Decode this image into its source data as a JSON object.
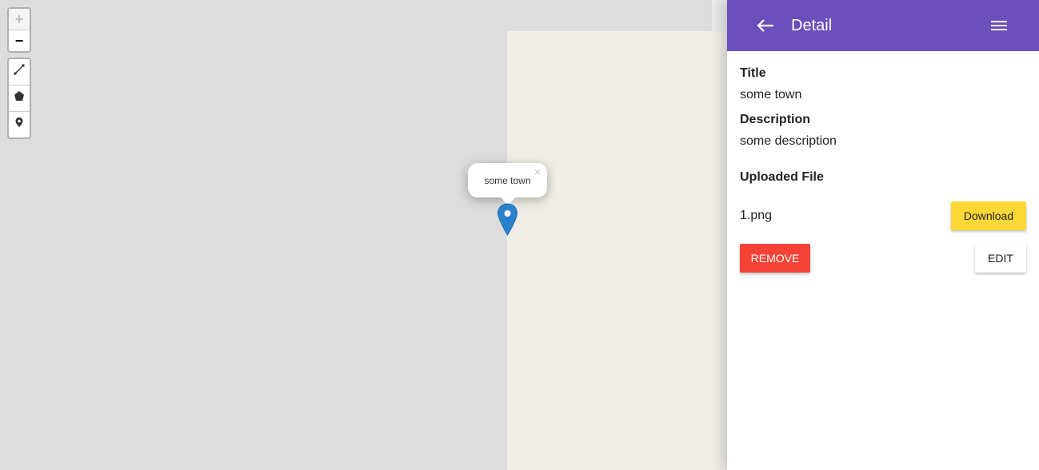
{
  "map": {
    "zoom_in_label": "+",
    "zoom_out_label": "−",
    "popup": {
      "text": "some town",
      "close_label": "×"
    }
  },
  "header": {
    "title": "Detail"
  },
  "detail": {
    "title_label": "Title",
    "title_value": "some town",
    "description_label": "Description",
    "description_value": "some description",
    "uploaded_label": "Uploaded File",
    "file_name": "1.png",
    "download_label": "Download",
    "remove_label": "REMOVE",
    "edit_label": "EDIT"
  },
  "colors": {
    "appbar": "#6b4fbb",
    "download": "#fdd835",
    "remove": "#f44336",
    "marker": "#2b82cb"
  }
}
